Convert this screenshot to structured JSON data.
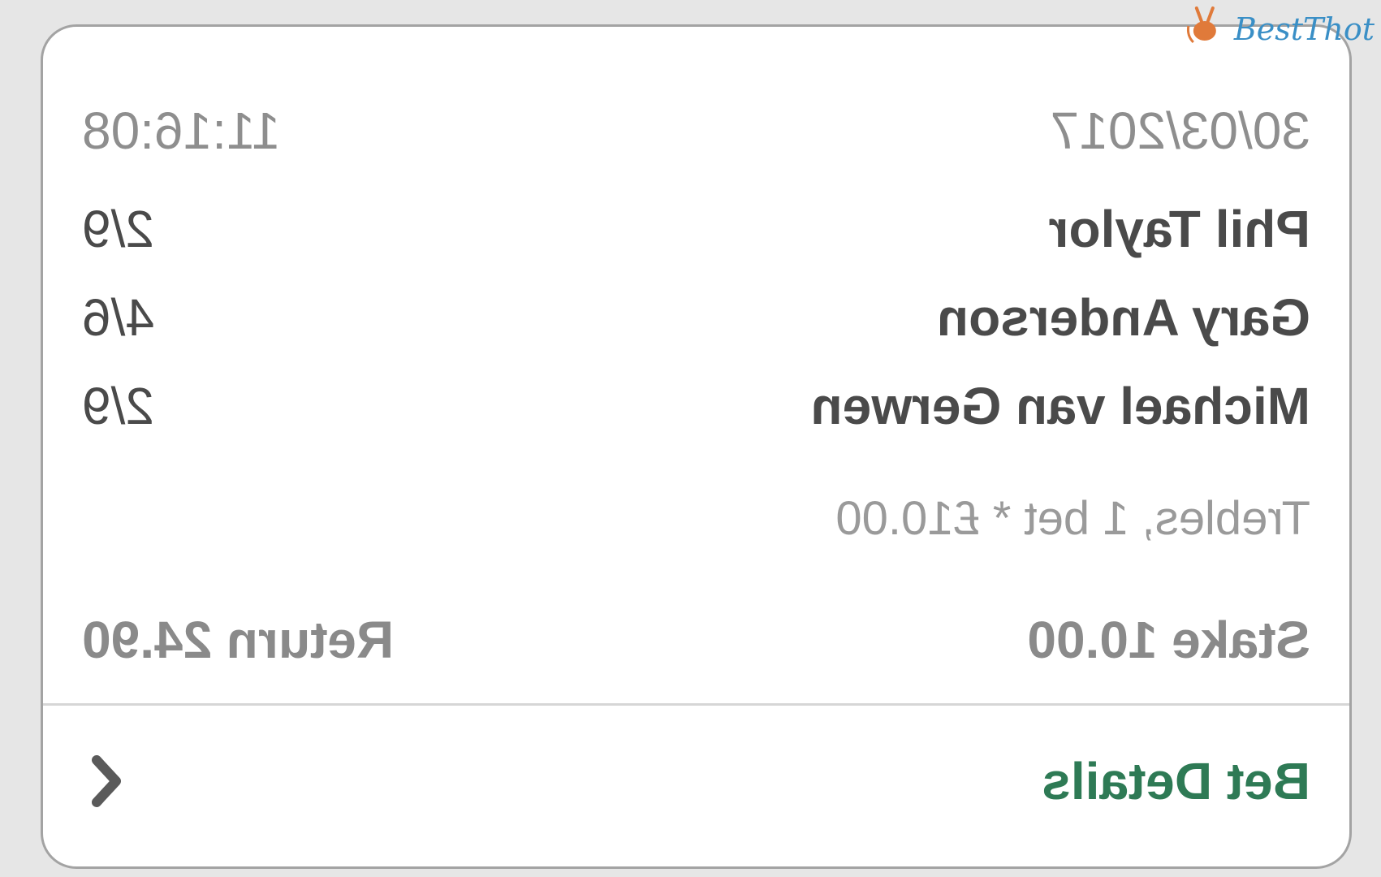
{
  "bet_receipt": {
    "date": "30/03/2017",
    "time": "11:16:08",
    "selections": [
      {
        "name": "Phil Taylor",
        "odds": "2/9"
      },
      {
        "name": "Gary Anderson",
        "odds": "4/6"
      },
      {
        "name": "Michael van Gerwen",
        "odds": "2/9"
      }
    ],
    "bet_type": "Trebles, 1 bet * £10.00",
    "stake": "Stake 10.00",
    "return": "Return 24.90"
  },
  "footer": {
    "title": "Bet Details",
    "toggle_icon": "chevron-left-icon"
  },
  "watermark": {
    "text": "BestThot",
    "icon": "bunny-logo-icon"
  },
  "colors": {
    "background": "#e6e6e6",
    "card": "#ffffff",
    "card_border": "#a3a3a3",
    "accent_green": "#2e7a55",
    "muted_text": "#8e8e8e",
    "primary_text": "#4a4a4a",
    "logo_blue": "#3a8fc6"
  }
}
